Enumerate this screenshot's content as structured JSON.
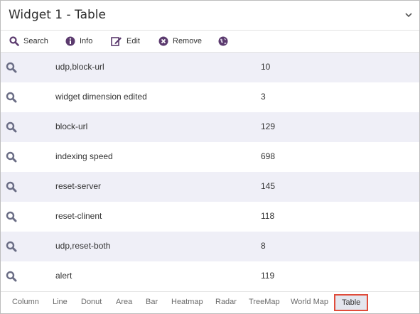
{
  "widget": {
    "title": "Widget 1 - Table",
    "collapse_icon": "chevron-down-icon"
  },
  "toolbar": {
    "search_label": "Search",
    "info_label": "Info",
    "edit_label": "Edit",
    "remove_label": "Remove",
    "globe_icon": "globe-icon"
  },
  "colors": {
    "accent": "#5b3a6e",
    "row_shade": "#efeff7",
    "active_tab_border": "#e04c3b"
  },
  "table": {
    "rows": [
      {
        "name": "udp,block-url",
        "value": "10"
      },
      {
        "name": "widget dimension edited",
        "value": "3"
      },
      {
        "name": "block-url",
        "value": "129"
      },
      {
        "name": "indexing speed",
        "value": "698"
      },
      {
        "name": "reset-server",
        "value": "145"
      },
      {
        "name": "reset-clinent",
        "value": "118"
      },
      {
        "name": "udp,reset-both",
        "value": "8"
      },
      {
        "name": "alert",
        "value": "119"
      }
    ]
  },
  "chart_tabs": {
    "items": [
      "Column",
      "Line",
      "Donut",
      "Area",
      "Bar",
      "Heatmap",
      "Radar",
      "TreeMap",
      "World Map",
      "Table"
    ],
    "active": "Table"
  }
}
